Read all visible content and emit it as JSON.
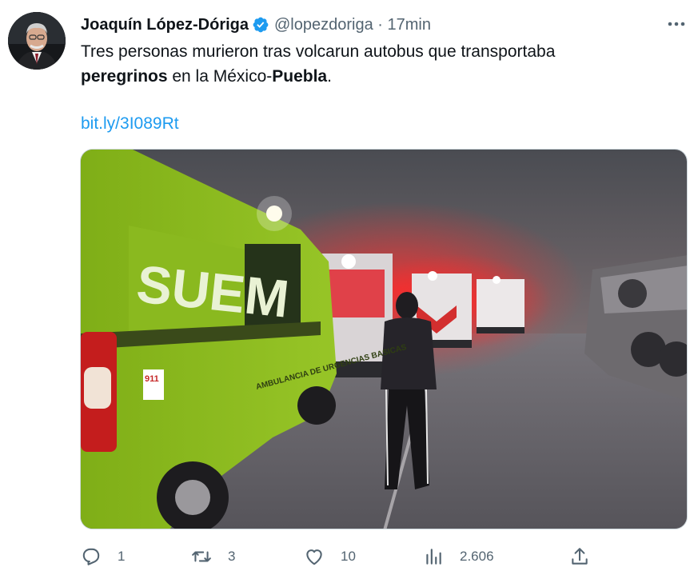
{
  "tweet": {
    "author_name": "Joaquín López-Dóriga",
    "handle_time": "@lopezdoriga · 17min",
    "text_line1": "Tres personas murieron tras volcarun autobus que transportaba",
    "text_bold1": "peregrinos",
    "text_mid": " en la México-",
    "text_bold2": "Puebla",
    "text_end": ".",
    "link": "bit.ly/3I089Rt",
    "media_text": {
      "van_side": "SUEM",
      "van_panel": "AMBULANCIA DE URGENCIAS BASICAS",
      "van_badge": "911"
    }
  },
  "actions": {
    "reply_count": "1",
    "retweet_count": "3",
    "like_count": "10",
    "views_count": "2.606"
  },
  "icons": {
    "verified": "verified-badge-icon",
    "more": "more-dots-icon",
    "reply": "reply-icon",
    "retweet": "retweet-icon",
    "like": "heart-icon",
    "views": "views-chart-icon",
    "share": "share-icon"
  },
  "colors": {
    "accent": "#1d9bf0",
    "secondary_text": "#536471",
    "ambulance_green": "#8fbf1f"
  }
}
